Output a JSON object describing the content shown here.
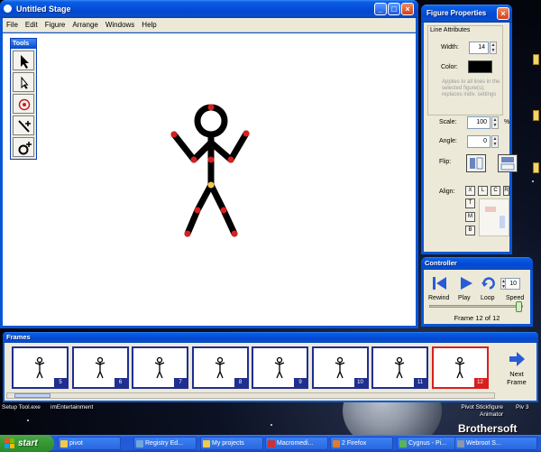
{
  "stage_window": {
    "title": "Untitled Stage",
    "menu": [
      "File",
      "Edit",
      "Figure",
      "Arrange",
      "Windows",
      "Help"
    ]
  },
  "tools": {
    "title": "Tools",
    "icons": [
      "select-arrow-icon",
      "point-arrow-icon",
      "origin-target-icon",
      "add-line-icon",
      "add-circle-icon"
    ]
  },
  "figure_properties": {
    "title": "Figure Properties",
    "line_attributes_label": "Line Attributes",
    "width_label": "Width:",
    "width_value": "14",
    "color_label": "Color:",
    "color_value": "#000000",
    "note": "Applies to all lines in the selected figure(s); replaces indiv. settings",
    "scale_label": "Scale:",
    "scale_value": "100",
    "scale_unit": "%",
    "angle_label": "Angle:",
    "angle_value": "0",
    "flip_label": "Flip:",
    "align_label": "Align:",
    "align_h": [
      "X",
      "L",
      "C",
      "R"
    ],
    "align_v": [
      "T",
      "M",
      "B"
    ]
  },
  "controller": {
    "title": "Controller",
    "frame_value": "10",
    "rewind_label": "Rewind",
    "play_label": "Play",
    "loop_label": "Loop",
    "speed_label": "Speed",
    "frame_status": "Frame 12 of 12",
    "slider_position": 1.0
  },
  "frames": {
    "title": "Frames",
    "items": [
      {
        "num": "5"
      },
      {
        "num": "6"
      },
      {
        "num": "7"
      },
      {
        "num": "8"
      },
      {
        "num": "9"
      },
      {
        "num": "10"
      },
      {
        "num": "11"
      },
      {
        "num": "12"
      }
    ],
    "selected_frame": "12",
    "next_label_1": "Next",
    "next_label_2": "Frame"
  },
  "desktop": {
    "left_labels": [
      "Setup Tool.exe",
      "imEntertainment"
    ],
    "right_labels": [
      "Pivot Stickfigure",
      "Animator"
    ],
    "version_label": "Piv 3",
    "watermark": "Brothersoft"
  },
  "taskbar": {
    "start_label": "start",
    "buttons": [
      {
        "label": "pivot",
        "icon_color": "#f2c94c"
      },
      {
        "label": "Registry Ed...",
        "icon_color": "#6fa8dc"
      },
      {
        "label": "My projects",
        "icon_color": "#f2c94c"
      },
      {
        "label": "Macromedi...",
        "icon_color": "#cc3333"
      },
      {
        "label": "2 Firefox",
        "icon_color": "#e07b2c"
      },
      {
        "label": "Cygnus - Pi...",
        "icon_color": "#5ab55a"
      },
      {
        "label": "Webroot S...",
        "icon_color": "#8899aa"
      }
    ]
  },
  "colors": {
    "xp_title": "#0348d2",
    "joint_red": "#d62020",
    "origin_joint": "#f2c94c",
    "frame_border": "#1f2e8f",
    "selected_frame_border": "#d62020"
  }
}
